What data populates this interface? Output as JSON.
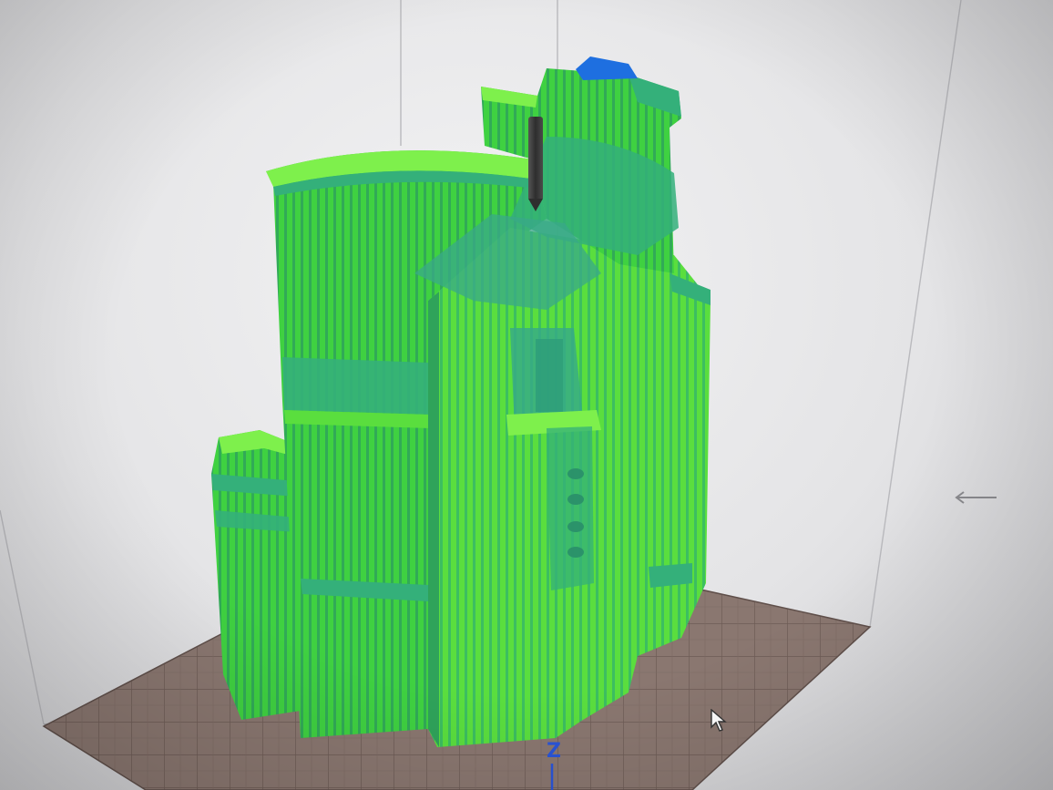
{
  "viewport": {
    "axis_label": "Z",
    "colors": {
      "model_main": "#3fd141",
      "model_shell": "#34b07a",
      "model_highlight": "#7ef04c",
      "bed_grid": "#7e6a63",
      "nozzle": "#3d3d3d",
      "travel_blue": "#1e6fe0",
      "axis_blue": "#2a55d8"
    },
    "icons": [
      "cursor-arrow-icon",
      "rotate-arrow-icon"
    ]
  }
}
